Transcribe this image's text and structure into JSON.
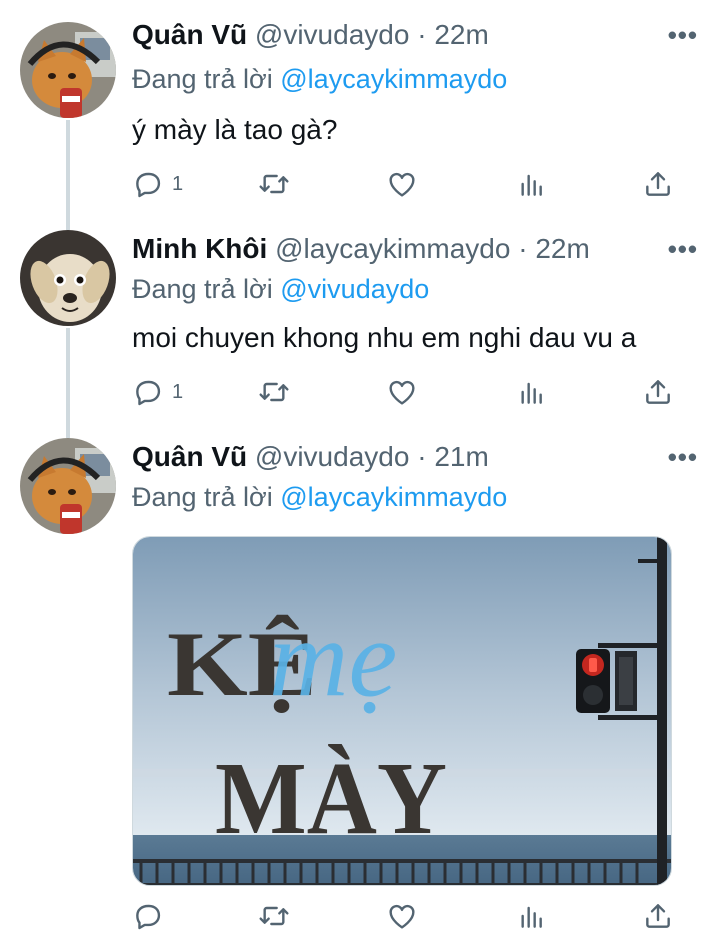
{
  "tweets": [
    {
      "name": "Quân Vũ",
      "handle": "@vivudaydo",
      "dot": "·",
      "time": "22m",
      "replying_prefix": "Đang trả lời ",
      "replying_to": "@laycaykimmaydo",
      "text": "ý mày là tao gà?",
      "reply_count": "1"
    },
    {
      "name": "Minh Khôi",
      "handle": "@laycaykimmaydo",
      "dot": "·",
      "time": "22m",
      "replying_prefix": "Đang trả lời ",
      "replying_to": "@vivudaydo",
      "text": "moi chuyen khong nhu em nghi dau vu a",
      "reply_count": "1"
    },
    {
      "name": "Quân Vũ",
      "handle": "@vivudaydo",
      "dot": "·",
      "time": "21m",
      "replying_prefix": "Đang trả lời ",
      "replying_to": "@laycaykimmaydo",
      "reply_count": ""
    }
  ],
  "media": {
    "line1": "KỆ",
    "script": "mẹ",
    "line2": "MÀY"
  },
  "colors": {
    "accent": "#1d9bf0",
    "secondary_text": "#536471",
    "thread_line": "#cfd9de"
  },
  "icons": [
    "more-icon",
    "reply-icon",
    "retweet-icon",
    "like-icon",
    "analytics-icon",
    "share-icon"
  ]
}
